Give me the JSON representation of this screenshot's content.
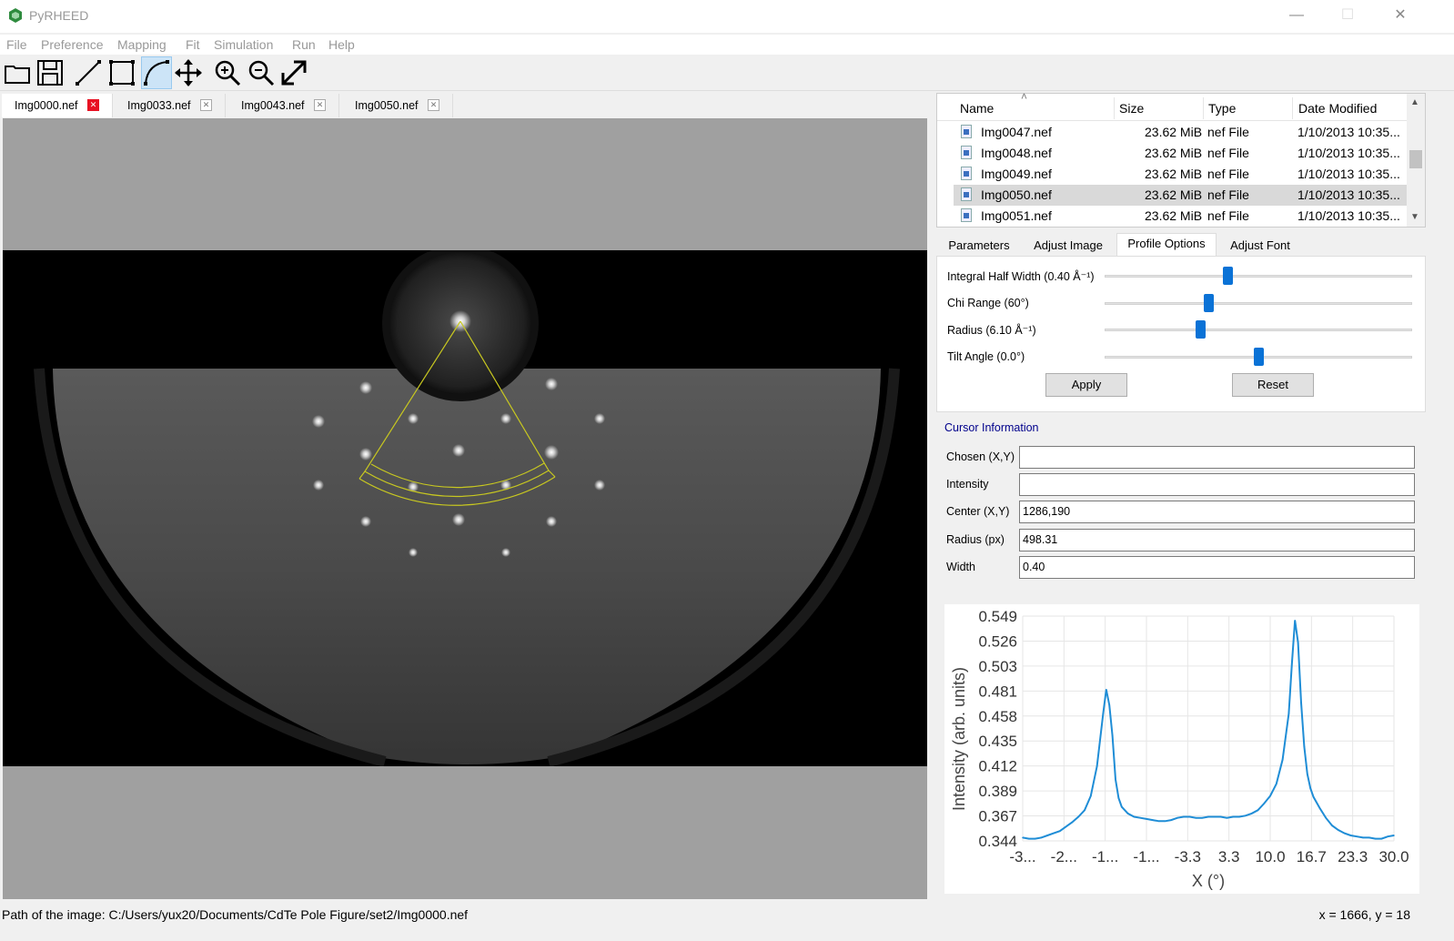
{
  "window": {
    "title": "PyRHEED",
    "minimize_icon": "—",
    "maximize_icon": "☐",
    "close_icon": "✕"
  },
  "menu": [
    "File",
    "Preference",
    "Mapping",
    "Fit",
    "Simulation",
    "Run",
    "Help"
  ],
  "toolbar": {
    "tools": [
      "open-folder-icon",
      "save-icon",
      "line-tool-icon",
      "rectangle-tool-icon",
      "arc-tool-icon",
      "move-icon",
      "zoom-in-icon",
      "zoom-out-icon",
      "fit-icon"
    ],
    "active": "arc-tool-icon"
  },
  "image_tabs": [
    {
      "label": "Img0000.nef",
      "active": true
    },
    {
      "label": "Img0033.nef",
      "active": false
    },
    {
      "label": "Img0043.nef",
      "active": false
    },
    {
      "label": "Img0050.nef",
      "active": false
    }
  ],
  "tab_close_glyph": "✕",
  "file_browser": {
    "columns": [
      "Name",
      "Size",
      "Type",
      "Date Modified"
    ],
    "rows": [
      {
        "name": "Img0047.nef",
        "size": "23.62 MiB",
        "type": "nef File",
        "date": "1/10/2013 10:35...",
        "selected": false
      },
      {
        "name": "Img0048.nef",
        "size": "23.62 MiB",
        "type": "nef File",
        "date": "1/10/2013 10:35...",
        "selected": false
      },
      {
        "name": "Img0049.nef",
        "size": "23.62 MiB",
        "type": "nef File",
        "date": "1/10/2013 10:35...",
        "selected": false
      },
      {
        "name": "Img0050.nef",
        "size": "23.62 MiB",
        "type": "nef File",
        "date": "1/10/2013 10:35...",
        "selected": true
      },
      {
        "name": "Img0051.nef",
        "size": "23.62 MiB",
        "type": "nef File",
        "date": "1/10/2013 10:35...",
        "selected": false
      }
    ],
    "scroll_up": "▲",
    "scroll_down": "▼",
    "sort_glyph": "˄"
  },
  "panel_tabs": [
    {
      "label": "Parameters",
      "active": false
    },
    {
      "label": "Adjust Image",
      "active": false
    },
    {
      "label": "Profile Options",
      "active": true
    },
    {
      "label": "Adjust Font",
      "active": false
    }
  ],
  "profile_options": {
    "sliders": [
      {
        "label": "Integral Half Width (0.40 Å⁻¹)",
        "value": 0.4
      },
      {
        "label": "Chi Range (60°)",
        "value": 0.34
      },
      {
        "label": "Radius (6.10 Å⁻¹)",
        "value": 0.31
      },
      {
        "label": "Tilt Angle (0.0°)",
        "value": 0.5
      }
    ],
    "apply": "Apply",
    "reset": "Reset"
  },
  "cursor_info": {
    "title": "Cursor Information",
    "fields": [
      {
        "label": "Chosen (X,Y)",
        "value": ""
      },
      {
        "label": "Intensity",
        "value": ""
      },
      {
        "label": "Center (X,Y)",
        "value": "1286,190"
      },
      {
        "label": "Radius (px)",
        "value": "498.31"
      },
      {
        "label": "Width",
        "value": "0.40"
      }
    ]
  },
  "chart_data": {
    "type": "line",
    "xlabel": "X (°)",
    "ylabel": "Intensity (arb. units)",
    "xlim": [
      -30,
      30
    ],
    "ylim": [
      0.344,
      0.549
    ],
    "x_tick_labels": [
      "-3...",
      "-2...",
      "-1...",
      "-1...",
      "-3.3",
      "3.3",
      "10.0",
      "16.7",
      "23.3",
      "30.0"
    ],
    "y_tick_labels": [
      "0.549",
      "0.526",
      "0.503",
      "0.481",
      "0.458",
      "0.435",
      "0.412",
      "0.389",
      "0.367",
      "0.344"
    ],
    "grid": true,
    "color": "#1f8dd6",
    "x": [
      -30,
      -29,
      -28,
      -27,
      -26,
      -25,
      -24,
      -23,
      -22,
      -21,
      -20,
      -19,
      -18,
      -17,
      -16.5,
      -16,
      -15.5,
      -15,
      -14.5,
      -14,
      -13,
      -12,
      -11,
      -10,
      -9,
      -8,
      -7,
      -6,
      -5,
      -4,
      -3,
      -2,
      -1,
      0,
      1,
      2,
      3,
      4,
      5,
      6,
      7,
      8,
      9,
      10,
      11,
      12,
      13,
      13.5,
      14,
      14.5,
      15,
      15.5,
      16,
      16.5,
      17,
      18,
      19,
      20,
      21,
      22,
      23,
      24,
      25,
      26,
      27,
      28,
      29,
      30
    ],
    "values": [
      0.347,
      0.346,
      0.346,
      0.347,
      0.349,
      0.351,
      0.353,
      0.357,
      0.361,
      0.366,
      0.372,
      0.385,
      0.412,
      0.46,
      0.482,
      0.468,
      0.44,
      0.4,
      0.383,
      0.375,
      0.369,
      0.366,
      0.365,
      0.364,
      0.363,
      0.362,
      0.362,
      0.363,
      0.365,
      0.366,
      0.366,
      0.365,
      0.365,
      0.366,
      0.366,
      0.366,
      0.365,
      0.366,
      0.366,
      0.367,
      0.369,
      0.372,
      0.378,
      0.385,
      0.396,
      0.418,
      0.46,
      0.505,
      0.545,
      0.525,
      0.47,
      0.43,
      0.405,
      0.392,
      0.384,
      0.374,
      0.365,
      0.358,
      0.354,
      0.351,
      0.349,
      0.348,
      0.347,
      0.347,
      0.346,
      0.346,
      0.348,
      0.349
    ]
  },
  "status": {
    "path": "Path of the image: C:/Users/yux20/Documents/CdTe Pole Figure/set2/Img0000.nef",
    "coords": "x = 1666, y = 18"
  }
}
